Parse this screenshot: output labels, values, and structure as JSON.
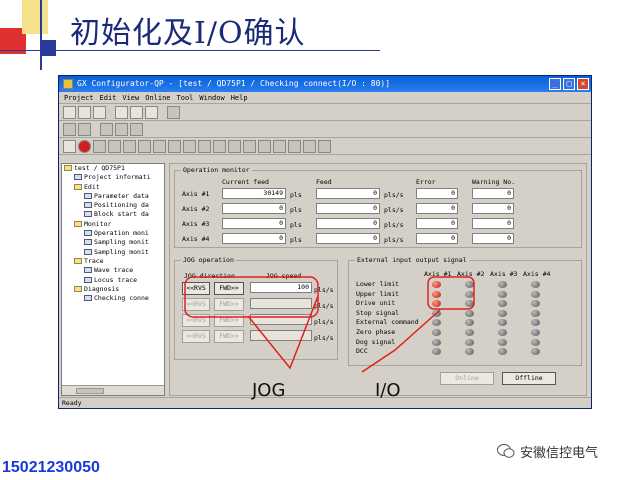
{
  "slide": {
    "title": "初始化及I/O确认",
    "phone": "15021230050",
    "brand": "安徽信控电气"
  },
  "window": {
    "title": "GX Configurator-QP - [test / QD75P1 / Checking connect(I/O : 80)]",
    "menu": [
      "Project",
      "Edit",
      "View",
      "Online",
      "Tool",
      "Window",
      "Help"
    ],
    "status": "Ready"
  },
  "tree": [
    {
      "label": "test / QD75P1",
      "level": 0,
      "type": "folder"
    },
    {
      "label": "Project informati",
      "level": 1,
      "type": "file"
    },
    {
      "label": "Edit",
      "level": 1,
      "type": "folder"
    },
    {
      "label": "Parameter data",
      "level": 2,
      "type": "file"
    },
    {
      "label": "Positioning da",
      "level": 2,
      "type": "file"
    },
    {
      "label": "Block start da",
      "level": 2,
      "type": "file"
    },
    {
      "label": "Monitor",
      "level": 1,
      "type": "folder"
    },
    {
      "label": "Operation moni",
      "level": 2,
      "type": "file"
    },
    {
      "label": "Sampling monit",
      "level": 2,
      "type": "file"
    },
    {
      "label": "Sampling monit",
      "level": 2,
      "type": "file"
    },
    {
      "label": "Trace",
      "level": 1,
      "type": "folder"
    },
    {
      "label": "Wave trace",
      "level": 2,
      "type": "file"
    },
    {
      "label": "Locus trace",
      "level": 2,
      "type": "file"
    },
    {
      "label": "Diagnosis",
      "level": 1,
      "type": "folder"
    },
    {
      "label": "Checking conne",
      "level": 2,
      "type": "file"
    }
  ],
  "opmon": {
    "label": "Operation monitor",
    "headers": [
      "Current feed",
      "Feed",
      "Error",
      "Warning No."
    ],
    "unit_pls": "pls",
    "unit_plss": "pls/s",
    "rows": [
      {
        "axis": "Axis #1",
        "cur": "30149",
        "feed": "0",
        "err": "0",
        "warn": "0"
      },
      {
        "axis": "Axis #2",
        "cur": "0",
        "feed": "0",
        "err": "0",
        "warn": "0"
      },
      {
        "axis": "Axis #3",
        "cur": "0",
        "feed": "0",
        "err": "0",
        "warn": "0"
      },
      {
        "axis": "Axis #4",
        "cur": "0",
        "feed": "0",
        "err": "0",
        "warn": "0"
      }
    ]
  },
  "jog": {
    "label": "JOG operation",
    "dir_label": "JOG direction",
    "speed_label": "JOG speed",
    "rvs": "<<RVS",
    "fwd": "FWD>>",
    "speed": "100",
    "unit": "pls/s"
  },
  "io": {
    "label": "External input output signal",
    "axes": [
      "Axis #1",
      "Axis #2",
      "Axis #3",
      "Axis #4"
    ],
    "signals": [
      "Lower limit",
      "Upper limit",
      "Drive unit",
      "Stop signal",
      "External command",
      "Zero phase",
      "Dog signal",
      "DCC"
    ],
    "on": [
      [
        true,
        false,
        false,
        false
      ],
      [
        true,
        false,
        false,
        false
      ],
      [
        true,
        false,
        false,
        false
      ],
      [
        false,
        false,
        false,
        false
      ],
      [
        false,
        false,
        false,
        false
      ],
      [
        false,
        false,
        false,
        false
      ],
      [
        false,
        false,
        false,
        false
      ],
      [
        false,
        false,
        false,
        false
      ]
    ]
  },
  "buttons": {
    "online": "Online",
    "offline": "Offline"
  },
  "annotations": {
    "jog": "JOG",
    "io": "I/O"
  },
  "colors": {
    "title_blue": "#1a2a7a",
    "annot_red": "#e02020",
    "phone_blue": "#1a3ad8"
  }
}
